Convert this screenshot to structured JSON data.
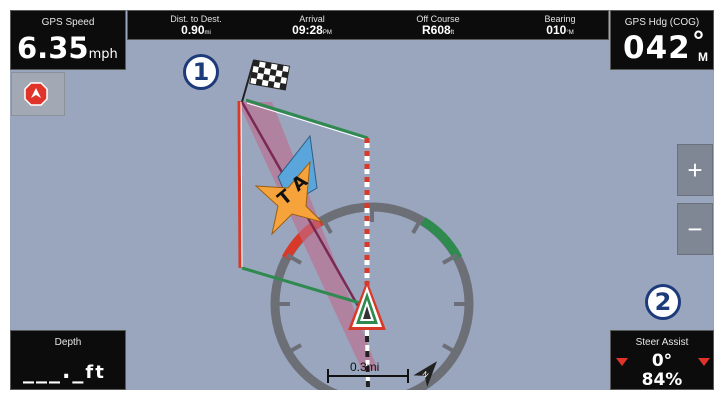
{
  "gps_speed": {
    "label": "GPS Speed",
    "value": "6.35",
    "unit": "mph"
  },
  "top_bar": [
    {
      "label": "Dist. to Dest.",
      "value": "0.90",
      "unit": "mi"
    },
    {
      "label": "Arrival",
      "value": "09:28",
      "unit": "PM"
    },
    {
      "label": "Off Course",
      "value": "R608",
      "unit": "ft"
    },
    {
      "label": "Bearing",
      "value": "010",
      "unit": "°M"
    }
  ],
  "gps_heading": {
    "label": "GPS Hdg (COG)",
    "value": "042",
    "unit_top": "°",
    "unit_bottom": "M"
  },
  "depth": {
    "label": "Depth",
    "value": "___._",
    "unit": "ft"
  },
  "steer_assist": {
    "label": "Steer Assist",
    "angle": "0°",
    "percent": "84%"
  },
  "scale": {
    "value": "0.3mi"
  },
  "zoom": {
    "plus": "+",
    "minus": "−"
  },
  "callouts": {
    "one": "1",
    "two": "2"
  },
  "target_marker": {
    "text": "TA"
  },
  "colors": {
    "map_bg": "#9aa6bd",
    "port": "#d83a2a",
    "starboard": "#2f8a4f",
    "course": "#8a2f5a",
    "wind_orange": "#f5a33a",
    "wind_blue": "#5aa6dc",
    "stop": "#e0342a"
  }
}
